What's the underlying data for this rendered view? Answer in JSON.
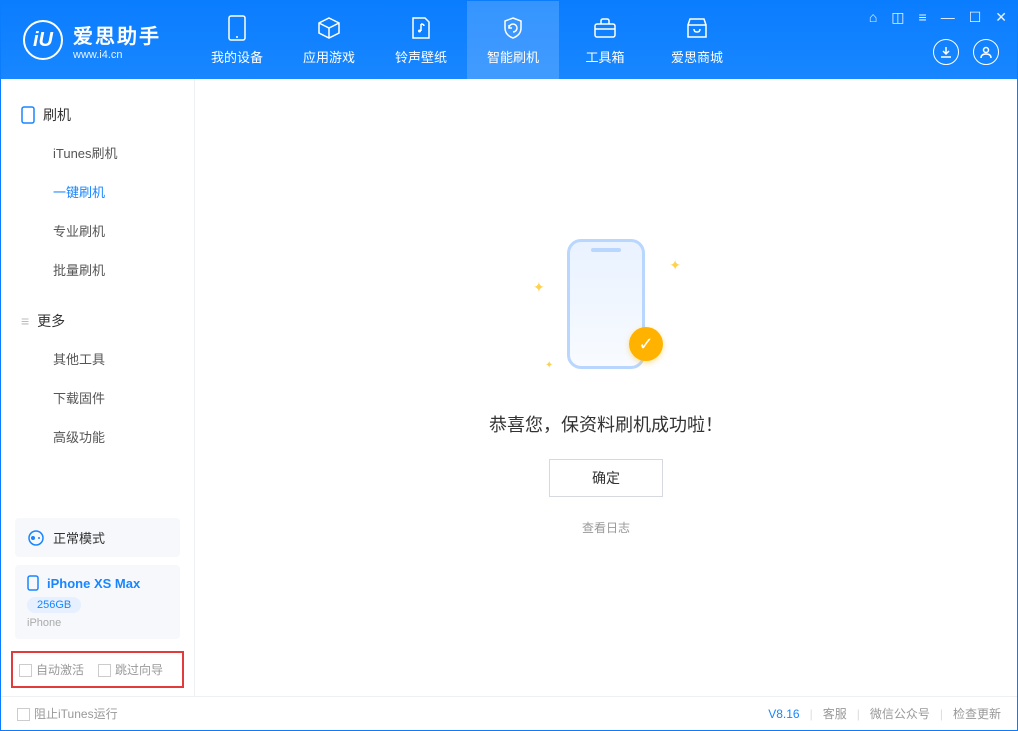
{
  "app": {
    "name": "爱思助手",
    "url": "www.i4.cn"
  },
  "tabs": {
    "device": "我的设备",
    "apps": "应用游戏",
    "ringtone": "铃声壁纸",
    "flash": "智能刷机",
    "toolbox": "工具箱",
    "store": "爱思商城"
  },
  "sidebar": {
    "group_flash": "刷机",
    "items_flash": {
      "itunes": "iTunes刷机",
      "onekey": "一键刷机",
      "pro": "专业刷机",
      "batch": "批量刷机"
    },
    "group_more": "更多",
    "items_more": {
      "other": "其他工具",
      "download": "下载固件",
      "advanced": "高级功能"
    },
    "mode_label": "正常模式",
    "device": {
      "name": "iPhone XS Max",
      "capacity": "256GB",
      "type": "iPhone"
    },
    "options": {
      "auto_activate": "自动激活",
      "skip_wizard": "跳过向导"
    }
  },
  "main": {
    "success_text": "恭喜您，保资料刷机成功啦！",
    "ok_button": "确定",
    "view_log": "查看日志"
  },
  "footer": {
    "block_itunes": "阻止iTunes运行",
    "version": "V8.16",
    "service": "客服",
    "wechat": "微信公众号",
    "update": "检查更新"
  }
}
